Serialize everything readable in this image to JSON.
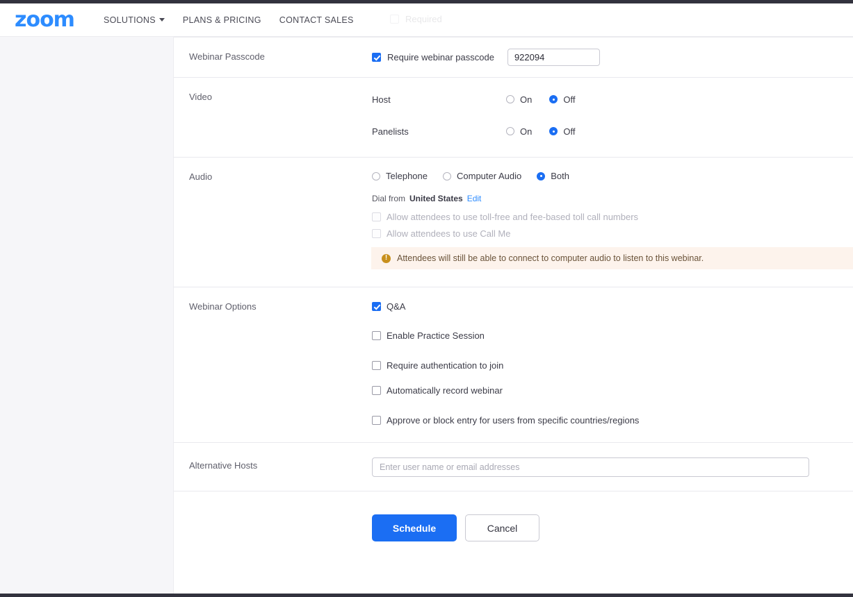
{
  "header": {
    "logo_text": "zoom",
    "nav": [
      {
        "label": "SOLUTIONS",
        "has_caret": true
      },
      {
        "label": "PLANS & PRICING",
        "has_caret": false
      },
      {
        "label": "CONTACT SALES",
        "has_caret": false
      }
    ]
  },
  "ghost": {
    "required_label": "Required"
  },
  "form": {
    "passcode": {
      "section_label": "Webinar Passcode",
      "checkbox_label": "Require webinar passcode",
      "checked": true,
      "value": "922094"
    },
    "video": {
      "section_label": "Video",
      "rows": [
        {
          "who": "Host",
          "on_label": "On",
          "off_label": "Off",
          "selected": "Off"
        },
        {
          "who": "Panelists",
          "on_label": "On",
          "off_label": "Off",
          "selected": "Off"
        }
      ]
    },
    "audio": {
      "section_label": "Audio",
      "options": [
        {
          "label": "Telephone",
          "selected": false
        },
        {
          "label": "Computer Audio",
          "selected": false
        },
        {
          "label": "Both",
          "selected": true
        }
      ],
      "dial_prefix": "Dial from",
      "dial_country": "United States",
      "edit_link": "Edit",
      "sub_options": [
        {
          "label": "Allow attendees to use toll-free and fee-based toll call numbers",
          "checked": false,
          "disabled": true
        },
        {
          "label": "Allow attendees to use Call Me",
          "checked": false,
          "disabled": true
        }
      ],
      "notice": {
        "icon": "warning-icon",
        "text": "Attendees will still be able to connect to computer audio to listen to this webinar."
      }
    },
    "webinar_options": {
      "section_label": "Webinar Options",
      "options": [
        {
          "label": "Q&A",
          "checked": true
        },
        {
          "label": "Enable Practice Session",
          "checked": false
        },
        {
          "label": "Require authentication to join",
          "checked": false
        },
        {
          "label": "Automatically record webinar",
          "checked": false
        },
        {
          "label": "Approve or block entry for users from specific countries/regions",
          "checked": false
        }
      ]
    },
    "alternative_hosts": {
      "section_label": "Alternative Hosts",
      "placeholder": "Enter user name or email addresses",
      "value": ""
    },
    "actions": {
      "schedule_label": "Schedule",
      "cancel_label": "Cancel"
    }
  },
  "colors": {
    "brand_blue": "#2D8CFF",
    "action_blue": "#1b6ef3",
    "notice_bg": "#fdf3ec",
    "notice_icon": "#c8901d",
    "sidebar_bg": "#f6f6f9",
    "chrome": "#32323e"
  }
}
